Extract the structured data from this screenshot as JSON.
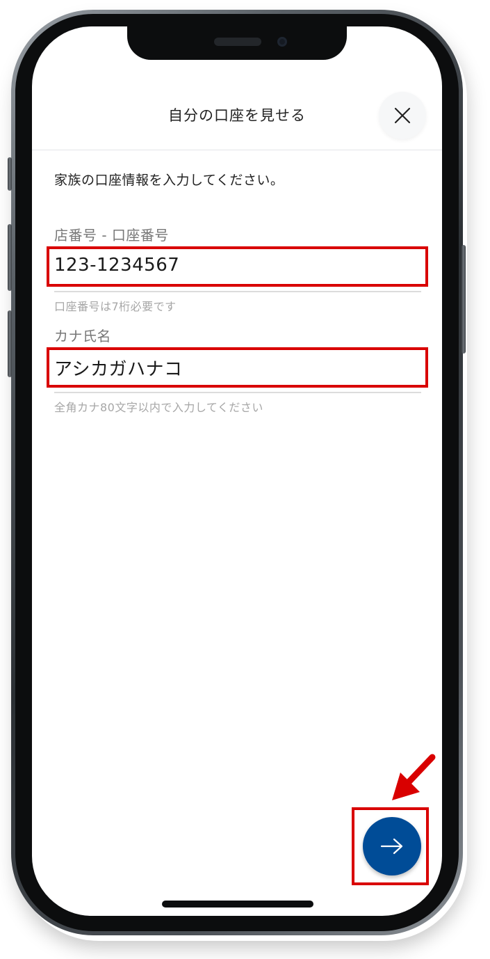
{
  "header": {
    "title": "自分の口座を見せる",
    "close_icon": "close-icon"
  },
  "form": {
    "instruction": "家族の口座情報を入力してください。",
    "account": {
      "label": "店番号 - 口座番号",
      "value": "123-1234567",
      "hint": "口座番号は7桁必要です"
    },
    "kana_name": {
      "label": "カナ氏名",
      "value": "アシカガハナコ",
      "hint": "全角カナ80文字以内で入力してください"
    }
  },
  "actions": {
    "next_icon": "arrow-right-icon"
  },
  "colors": {
    "accent": "#004c97",
    "highlight": "#d90000"
  }
}
